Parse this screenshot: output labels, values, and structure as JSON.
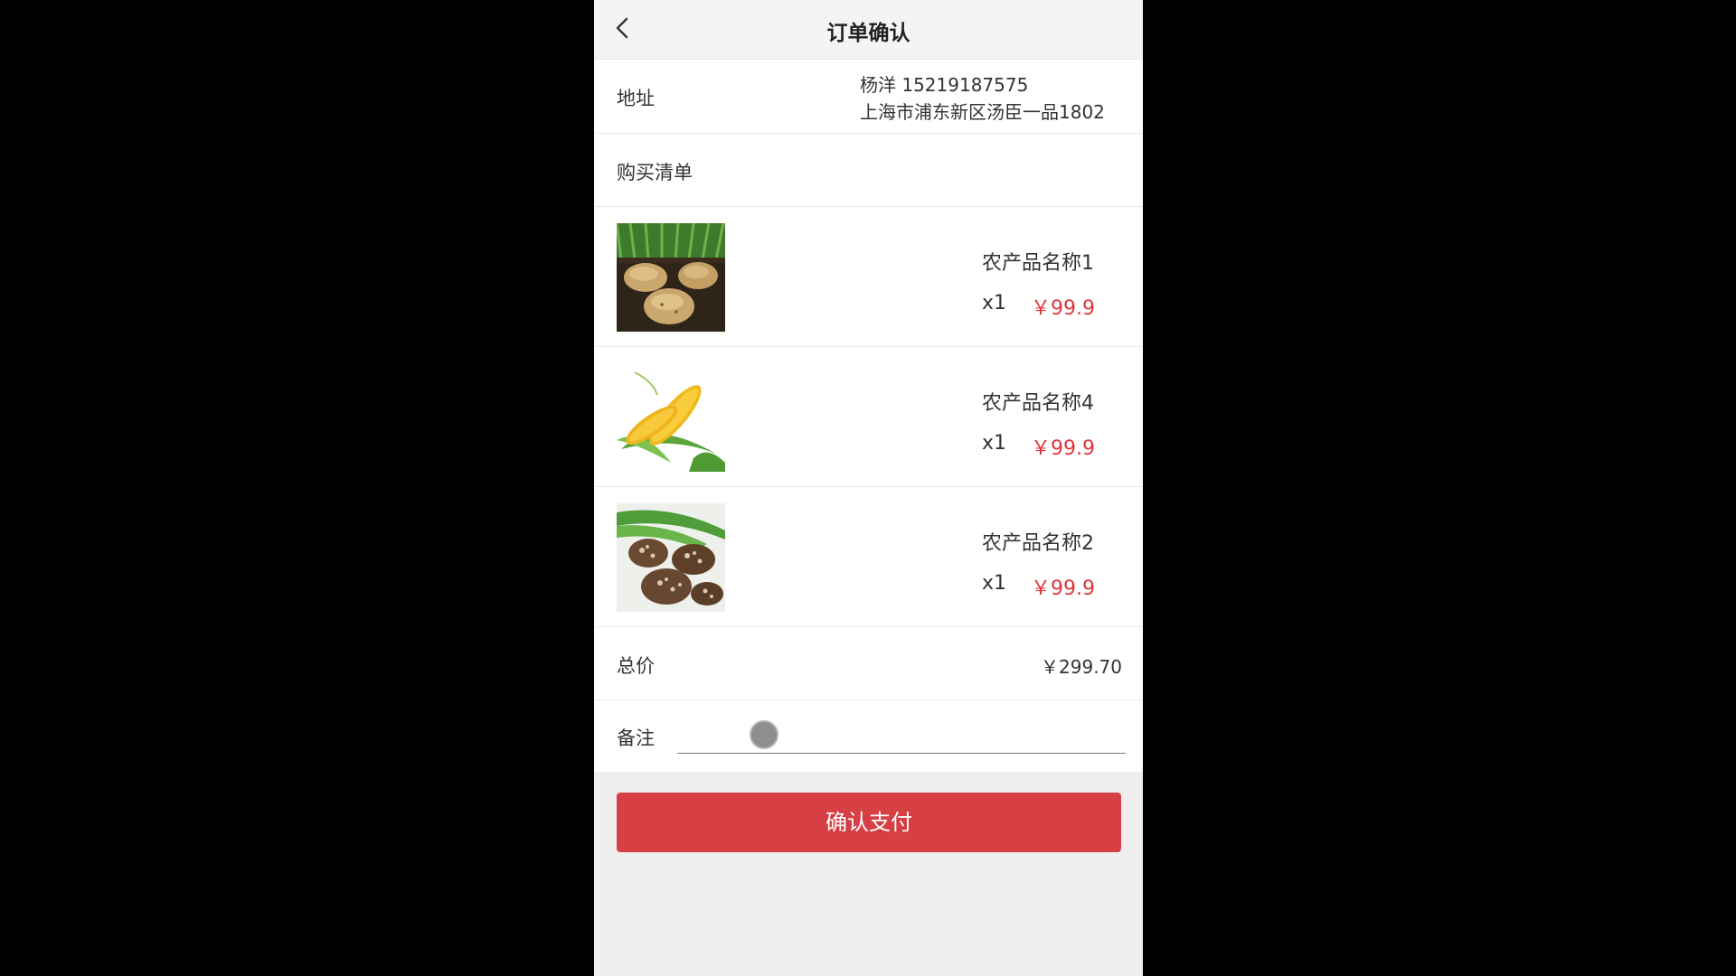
{
  "header": {
    "title": "订单确认",
    "back_icon": "chevron-left-icon"
  },
  "address": {
    "label": "地址",
    "name_phone": "杨洋 15219187575",
    "detail": "上海市浦东新区汤臣一品1802"
  },
  "list": {
    "label": "购买清单"
  },
  "items": [
    {
      "name": "农产品名称1",
      "qty": "x1",
      "price": "￥99.9",
      "image": "potatoes"
    },
    {
      "name": "农产品名称4",
      "qty": "x1",
      "price": "￥99.9",
      "image": "corn"
    },
    {
      "name": "农产品名称2",
      "qty": "x1",
      "price": "￥99.9",
      "image": "shiitake-mushrooms"
    }
  ],
  "total": {
    "label": "总价",
    "value": "￥299.70"
  },
  "note": {
    "label": "备注",
    "value": "",
    "placeholder": ""
  },
  "pay_button": {
    "label": "确认支付"
  },
  "colors": {
    "price": "#e0353d",
    "button": "#d64045",
    "background": "#efefef"
  }
}
